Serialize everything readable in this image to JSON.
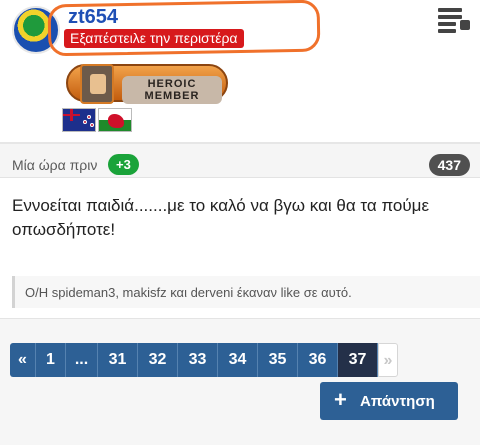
{
  "profile": {
    "username": "zt654",
    "user_title": "Εξαπέστειλε την περιστέρα",
    "rank_label": "HEROIC MEMBER",
    "flags": [
      "new-zealand-flag",
      "wales-flag"
    ],
    "highlight_color": "#f0712b"
  },
  "post": {
    "time": "Μία ώρα πριν",
    "reaction_badge": "+3",
    "post_number": "437",
    "text": "Εννοείται παιδιά.......με το καλό να βγω και θα τα πούμε οπωσδήποτε!",
    "likes": "O/H spideman3, makisfz και derveni έκαναν like σε αυτό."
  },
  "pagination": {
    "first": "«",
    "pages": [
      "1",
      "...",
      "31",
      "32",
      "33",
      "34",
      "35",
      "36",
      "37"
    ],
    "current": "37",
    "next": "»"
  },
  "actions": {
    "reply_icon": "+",
    "reply_label": "Απάντηση"
  },
  "colors": {
    "link_blue": "#1f4fb5",
    "badge_red": "#d7191c",
    "button_blue": "#2d6095",
    "current_page": "#243049",
    "reaction_green": "#1aa33a"
  }
}
